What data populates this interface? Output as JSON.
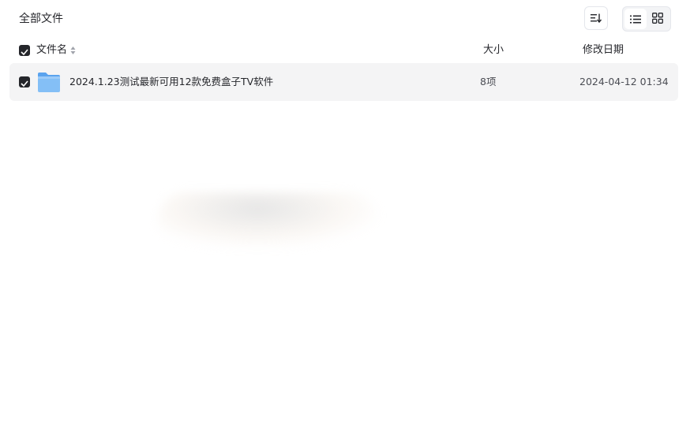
{
  "header": {
    "title": "全部文件"
  },
  "toolbar": {
    "sort_icon": "sort-descending-icon",
    "view_list_icon": "list-view-icon",
    "view_grid_icon": "grid-view-icon",
    "active_view": "list"
  },
  "columns": {
    "name": "文件名",
    "size": "大小",
    "date": "修改日期"
  },
  "files": [
    {
      "name": "2024.1.23测试最新可用12款免费盒子TV软件",
      "size": "8项",
      "date": "2024-04-12 01:34",
      "type": "folder",
      "checked": true
    }
  ],
  "colors": {
    "accent": "#25262b",
    "row_bg": "#f4f4f5",
    "folder": "#7ab8f5"
  }
}
